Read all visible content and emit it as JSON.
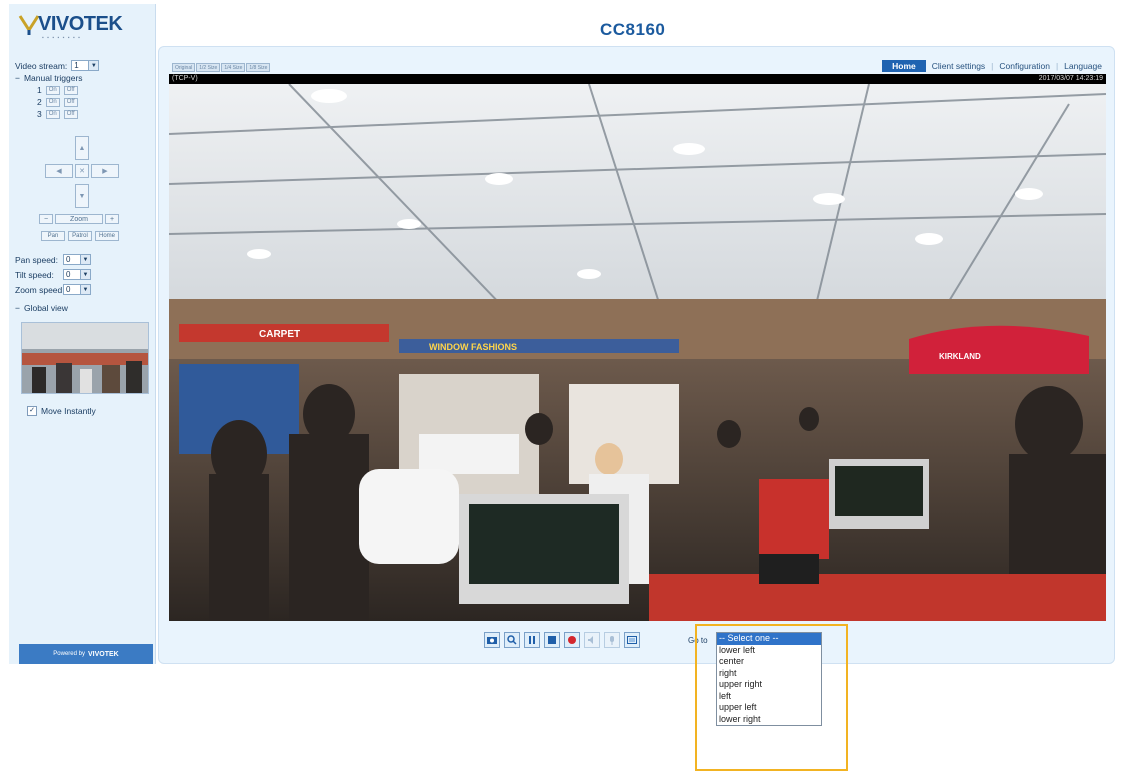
{
  "header": {
    "logo": "VIVOTEK",
    "title": "CC8160"
  },
  "sidebar": {
    "video_stream_label": "Video stream:",
    "video_stream_value": "1",
    "manual_triggers_label": "Manual triggers",
    "triggers": [
      {
        "num": "1",
        "on": "On",
        "off": "Off"
      },
      {
        "num": "2",
        "on": "On",
        "off": "Off"
      },
      {
        "num": "3",
        "on": "On",
        "off": "Off"
      }
    ],
    "zoom_label": "Zoom",
    "zoom_minus": "−",
    "zoom_plus": "+",
    "func_buttons": [
      "Pan",
      "Patrol",
      "Home"
    ],
    "pan_speed_label": "Pan speed:",
    "pan_speed_value": "0",
    "tilt_speed_label": "Tilt speed:",
    "tilt_speed_value": "0",
    "zoom_speed_label": "Zoom speed:",
    "zoom_speed_value": "0",
    "global_view_label": "Global view",
    "move_instantly_label": "Move Instantly",
    "powered_by": "Powered by",
    "powered_brand": "VIVOTEK"
  },
  "nav": {
    "size_buttons": [
      "Original",
      "1/2 Size",
      "1/4 Size",
      "1/8 Size"
    ],
    "items": [
      "Home",
      "Client settings",
      "Configuration",
      "Language"
    ]
  },
  "video": {
    "stream_label": "(TCP-V)",
    "timestamp": "2017/03/07 14:23:19",
    "signs": {
      "carpet": "CARPET",
      "window": "WINDOW FASHIONS",
      "kirkland": "KIRKLAND"
    }
  },
  "controls": {
    "buttons": [
      "snapshot-icon",
      "digital-zoom-icon",
      "pause-icon",
      "stop-icon",
      "record-icon",
      "volume-icon",
      "talk-icon",
      "fullscreen-icon"
    ]
  },
  "goto": {
    "label": "Go to",
    "options": [
      "-- Select one --",
      "lower left",
      "center",
      "right",
      "upper right",
      "left",
      "upper left",
      "lower right"
    ],
    "selected": "-- Select one --"
  },
  "colors": {
    "accent": "#1b5a9e",
    "highlight": "#f2b322",
    "selected_option": "#2f73c9"
  }
}
